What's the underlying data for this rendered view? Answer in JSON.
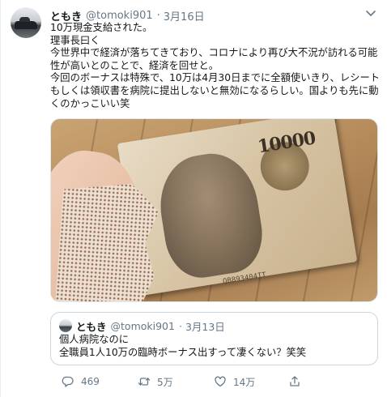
{
  "tweet": {
    "display_name": "ともき",
    "handle": "@tomoki901",
    "separator": "·",
    "date": "3月16日",
    "lines": [
      "10万現金支給された。",
      "理事長曰く",
      "今世界中で経済が落ちてきており、コロナにより再び大不況が訪れる可能",
      "性が高いとのことで、経済を回せと。",
      "今回のボーナスは特殊で、10万は4月30日までに全額使いきり、レシート",
      "もしくは領収書を病院に提出しないと無効になるらしい。国よりも先に動",
      "くのかっこいい笑"
    ],
    "photo": {
      "denomination": "10000",
      "serial": "QB893404IT"
    }
  },
  "quoted_tweet": {
    "display_name": "ともき",
    "handle": "@tomoki901",
    "separator": "·",
    "date": "3月13日",
    "lines": [
      "個人病院なのに",
      "全職員1人10万の臨時ボーナス出すって凄くない？笑笑"
    ]
  },
  "actions": {
    "reply_count": "469",
    "retweet_count": "5万",
    "like_count": "14万"
  },
  "icons": {
    "reply": "reply-icon",
    "retweet": "retweet-icon",
    "like": "heart-icon",
    "share": "share-icon",
    "menu": "chevron-down-icon"
  },
  "colors": {
    "secondary_text": "#657786",
    "border": "#ccd6dd"
  }
}
